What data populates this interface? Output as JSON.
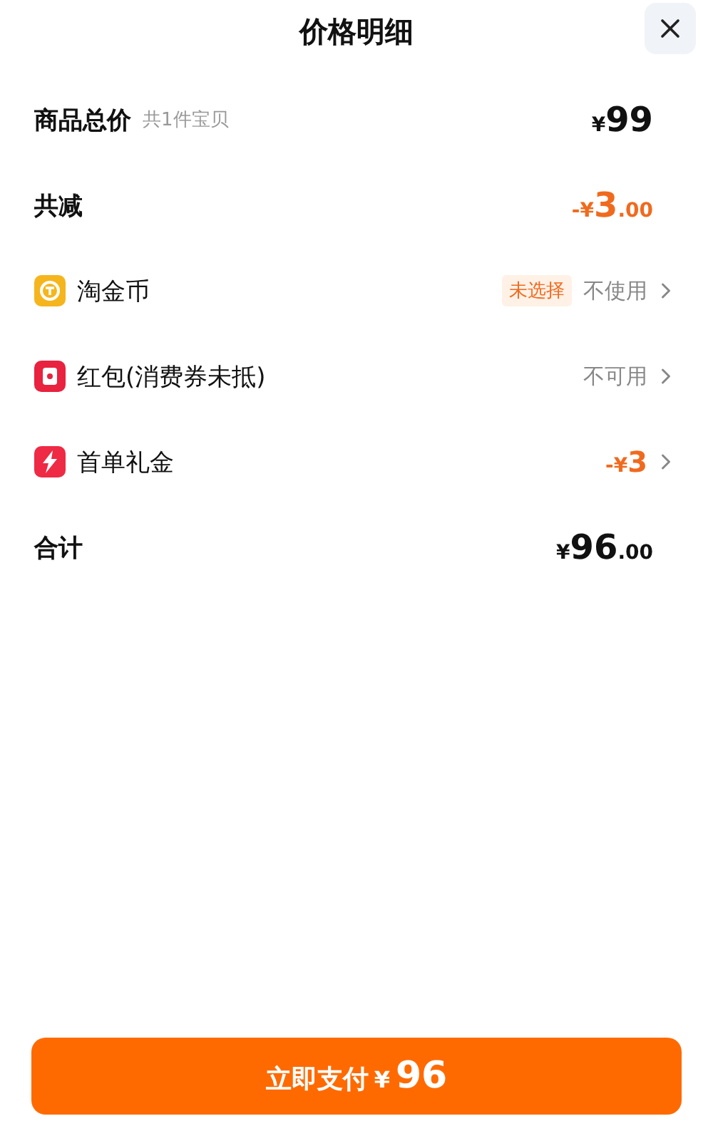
{
  "title": "价格明细",
  "rows": [
    {
      "kind": "total",
      "label": "商品总价",
      "note": "共1件宝贝",
      "amount": {
        "currency": "¥",
        "integer": "99"
      },
      "accent": false
    },
    {
      "kind": "total",
      "label": "共减",
      "amount": {
        "sign": "-",
        "currency": "¥",
        "integer": "3",
        "decimals": ".00"
      },
      "accent": true
    },
    {
      "kind": "coin",
      "label": "淘金币",
      "tag": "未选择",
      "value": "不使用"
    },
    {
      "kind": "envelope",
      "label": "红包(消费券未抵)",
      "value": "不可用"
    },
    {
      "kind": "bolt",
      "label": "首单礼金",
      "amount": {
        "sign": "-",
        "currency": "¥",
        "integer": "3"
      },
      "accent": true
    },
    {
      "kind": "total",
      "label": "合计",
      "amount": {
        "currency": "¥",
        "integer": "96",
        "decimals": ".00"
      },
      "accent": false
    }
  ],
  "pay_button": {
    "label": "立即支付",
    "currency": "¥",
    "amount": "96"
  }
}
